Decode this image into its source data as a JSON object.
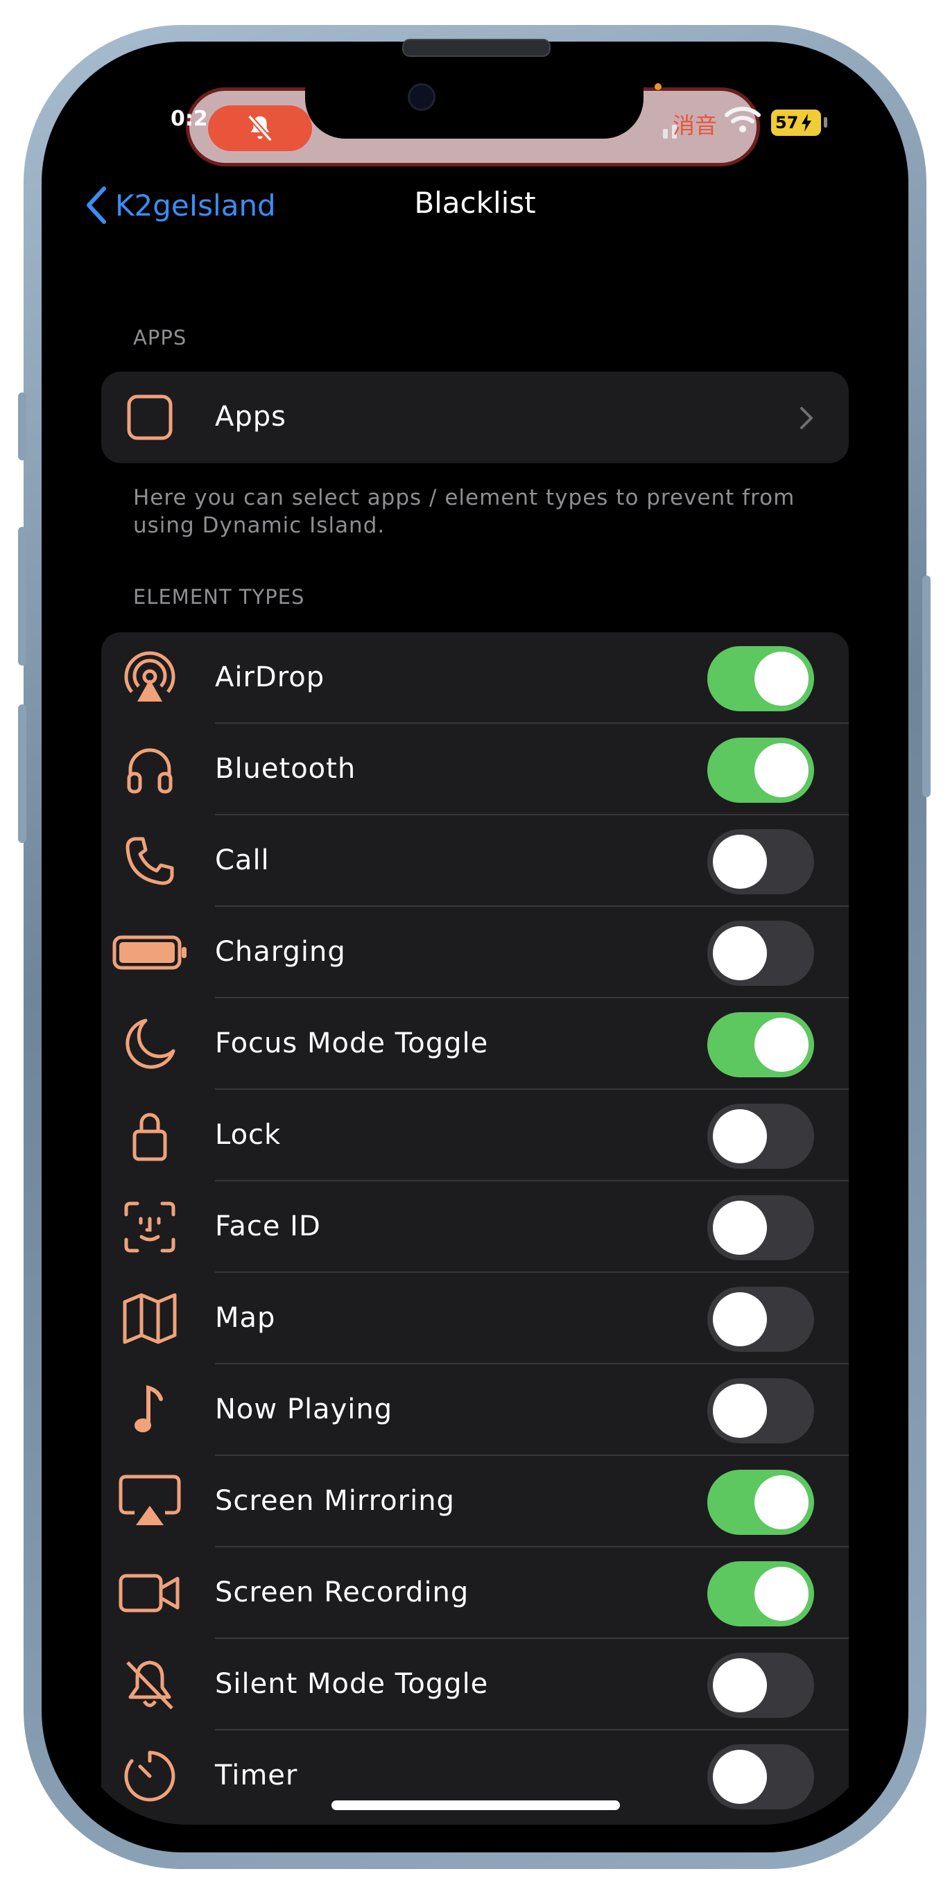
{
  "status_bar": {
    "time": "0:2",
    "mute_icon": "bell-slash-icon",
    "carrier_text": "消音",
    "battery_level": "57",
    "battery_charging": true
  },
  "nav": {
    "back_label": "K2geIsland",
    "title": "Blacklist"
  },
  "apps_section": {
    "header": "APPS",
    "row_label": "Apps",
    "footer": "Here you can select apps / element types to prevent from using Dynamic Island."
  },
  "element_section": {
    "header": "ELEMENT TYPES",
    "items": [
      {
        "label": "AirDrop",
        "icon": "airdrop-icon",
        "enabled": true
      },
      {
        "label": "Bluetooth",
        "icon": "headphones-icon",
        "enabled": true
      },
      {
        "label": "Call",
        "icon": "phone-icon",
        "enabled": false
      },
      {
        "label": "Charging",
        "icon": "battery-icon",
        "enabled": false
      },
      {
        "label": "Focus Mode Toggle",
        "icon": "moon-icon",
        "enabled": true
      },
      {
        "label": "Lock",
        "icon": "lock-icon",
        "enabled": false
      },
      {
        "label": "Face ID",
        "icon": "face-id-icon",
        "enabled": false
      },
      {
        "label": "Map",
        "icon": "map-icon",
        "enabled": false
      },
      {
        "label": "Now Playing",
        "icon": "music-note-icon",
        "enabled": false
      },
      {
        "label": "Screen Mirroring",
        "icon": "airplay-icon",
        "enabled": true
      },
      {
        "label": "Screen Recording",
        "icon": "video-camera-icon",
        "enabled": true
      },
      {
        "label": "Silent Mode Toggle",
        "icon": "bell-slash-icon",
        "enabled": false
      },
      {
        "label": "Timer",
        "icon": "timer-icon",
        "enabled": false
      }
    ]
  },
  "colors": {
    "accent_icon": "#f0a27a",
    "toggle_on": "#5dc760",
    "toggle_off": "#39393d",
    "link": "#3a8ef6"
  }
}
